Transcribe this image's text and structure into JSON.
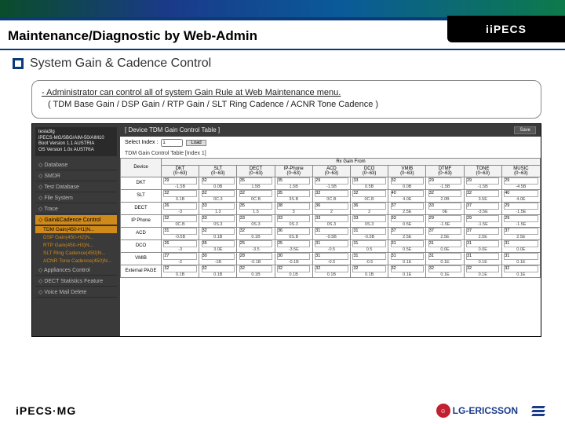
{
  "header": {
    "logo_text": "iPECS"
  },
  "title": "Maintenance/Diagnostic by Web-Admin",
  "subtitle": "System Gain & Cadence Control",
  "description": {
    "line1": "- Administrator can control all of system Gain Rule at Web Maintenance menu.",
    "line2": "( TDM Base Gain / DSP Gain / RTP Gain / SLT Ring Cadence / ACNR Tone Cadence )"
  },
  "screenshot": {
    "info": {
      "l1": "tesla3lg",
      "l2": "iPECS-MG/SBG/AIM-50/AIM10",
      "l3": "Boot Version 1.1 AUSTRIA",
      "l4": "OS Version 1.0x AUSTRIA"
    },
    "nav": {
      "database": "◇ Database",
      "smdr": "◇ SMDR",
      "test": "◇ Test Database",
      "file": "◇ File System",
      "trace": "◇ Trace",
      "gain": "◇ Gain&Cadence Control",
      "sub1": "TDM Gain(450-H1)N...",
      "sub2": "DSP Gain(450-H2)N...",
      "sub3": "RTP Gain(450-H3)N...",
      "sub4": "SLT Ring Cadence(450)N...",
      "sub5": "ACNR Tone Cadence(450)N...",
      "app": "◇ Appliances Control",
      "dect": "◇ DECT Statistics Feature",
      "voice": "◇ Voice Mail Delete"
    },
    "panel_title": "[ Device TDM Gain Control Table ]",
    "save_label": "Save",
    "select_label": "Select Index :",
    "select_val": "1",
    "load_label": "Load",
    "head2": "TDM Gain Control Table [Index 1]",
    "grp_header": "Rx Gain From",
    "cols": [
      "Device",
      "DKT\n(0~63)",
      "SLT\n(0~63)",
      "DECT\n(0~63)",
      "IP-Phone\n(0~63)",
      "ACD\n(0~63)",
      "DCO\n(0~63)",
      "VMIB\n(0~63)",
      "DTMF\n(0~63)",
      "TONE\n(0~63)",
      "MUSIC\n(0~63)"
    ],
    "rows": [
      {
        "dev": "DKT",
        "vals": [
          [
            "29",
            "-1.5B"
          ],
          [
            "32",
            "0.0B"
          ],
          [
            "35",
            "1.5B"
          ],
          [
            "35",
            "1.5B"
          ],
          [
            "29",
            "-1.5B"
          ],
          [
            "33",
            "0.5B"
          ],
          [
            "32",
            "0.0B"
          ],
          [
            "29",
            "-1.5B"
          ],
          [
            "29",
            "-1.5B"
          ],
          [
            "29",
            "-4.5B"
          ]
        ]
      },
      {
        "dev": "SLT",
        "vals": [
          [
            "32",
            "0.1B"
          ],
          [
            "32",
            "0C.3"
          ],
          [
            "32",
            "0C.B"
          ],
          [
            "35",
            "3S.B"
          ],
          [
            "32",
            "0C.B"
          ],
          [
            "32",
            "0C.B"
          ],
          [
            "40",
            "4.0E"
          ],
          [
            "32",
            "2.0B"
          ],
          [
            "32",
            "3.5E"
          ],
          [
            "40",
            "4.0E"
          ]
        ]
      },
      {
        "dev": "DECT",
        "vals": [
          [
            "26",
            "-3"
          ],
          [
            "33",
            "1.3"
          ],
          [
            "35",
            "1.5"
          ],
          [
            "38",
            "3"
          ],
          [
            "36",
            "2"
          ],
          [
            "36",
            "2"
          ],
          [
            "37",
            "2.5E"
          ],
          [
            "33",
            "0E"
          ],
          [
            "37",
            "-3.5E"
          ],
          [
            "29",
            "-1.5E"
          ]
        ]
      },
      {
        "dev": "IP Phone",
        "vals": [
          [
            "32",
            "0C.B"
          ],
          [
            "33",
            "0S.3"
          ],
          [
            "33",
            "0S.3"
          ],
          [
            "33",
            "0S.3"
          ],
          [
            "33",
            "0S.3"
          ],
          [
            "33",
            "0S.3"
          ],
          [
            "33",
            "0.5E"
          ],
          [
            "29",
            "-1.5E"
          ],
          [
            "29",
            "-1.5E"
          ],
          [
            "29",
            "-1.5E"
          ]
        ]
      },
      {
        "dev": "ACD",
        "vals": [
          [
            "31",
            "-0.5B"
          ],
          [
            "32",
            "0.1B"
          ],
          [
            "32",
            "0.1B"
          ],
          [
            "36",
            "0S.B"
          ],
          [
            "31",
            "-0.5B"
          ],
          [
            "31",
            "-0.5B"
          ],
          [
            "37",
            "2.5E"
          ],
          [
            "37",
            "2.5E"
          ],
          [
            "37",
            "2.5E"
          ],
          [
            "37",
            "2.5E"
          ]
        ]
      },
      {
        "dev": "DCO",
        "vals": [
          [
            "26",
            "-3"
          ],
          [
            "35",
            "3.0E"
          ],
          [
            "25",
            "-3.5"
          ],
          [
            "25",
            "-3.5E"
          ],
          [
            "31",
            "-0.5"
          ],
          [
            "31",
            "0.5"
          ],
          [
            "31",
            "0.5E"
          ],
          [
            "31",
            "0.0E"
          ],
          [
            "31",
            "0.0E"
          ],
          [
            "31",
            "0.0E"
          ]
        ]
      },
      {
        "dev": "VMIB",
        "vals": [
          [
            "27",
            "-2"
          ],
          [
            "30",
            "-1B"
          ],
          [
            "28",
            "-0.1B"
          ],
          [
            "30",
            "-0.1B"
          ],
          [
            "31",
            "-0.5"
          ],
          [
            "31",
            "-0.5"
          ],
          [
            "31",
            "0.1E"
          ],
          [
            "31",
            "0.1E"
          ],
          [
            "31",
            "0.1E"
          ],
          [
            "31",
            "0.1E"
          ]
        ]
      },
      {
        "dev": "External PAGE",
        "vals": [
          [
            "32",
            "0.1B"
          ],
          [
            "32",
            "0.1B"
          ],
          [
            "32",
            "0.1B"
          ],
          [
            "32",
            "0.1B"
          ],
          [
            "32",
            "0.1B"
          ],
          [
            "32",
            "0.1B"
          ],
          [
            "32",
            "0.1E"
          ],
          [
            "32",
            "0.1E"
          ],
          [
            "32",
            "0.1E"
          ],
          [
            "32",
            "0.1E"
          ]
        ]
      }
    ]
  },
  "footer": {
    "left": "iPECS·MG",
    "lg": "LG-ERICSSON"
  }
}
